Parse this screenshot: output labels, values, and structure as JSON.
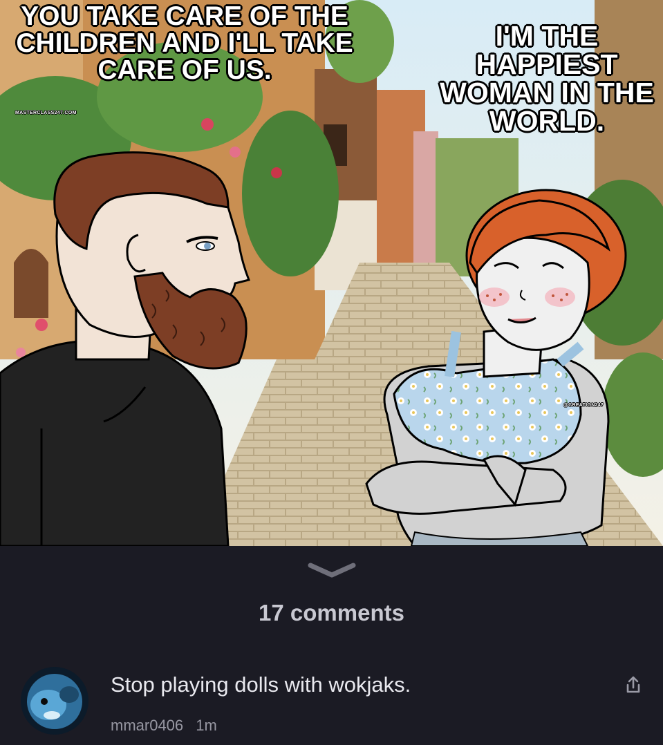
{
  "meme": {
    "caption_left": "YOU TAKE CARE OF THE CHILDREN AND I'LL TAKE CARE OF US.",
    "caption_right": "I'M THE HAPPIEST WOMAN IN THE WORLD.",
    "watermark_left": "MASTERCLASS247.COM",
    "watermark_right": "@CREATION247"
  },
  "comments": {
    "count_label": "17 comments",
    "expand_icon": "chevron-down-icon",
    "items": [
      {
        "text": "Stop playing dolls with wokjaks.",
        "username": "mmar0406",
        "time": "1m",
        "share_icon": "share-icon"
      }
    ]
  },
  "colors": {
    "background": "#1b1b24",
    "count_text": "#c9c9d2",
    "comment_text": "#e9e9ef",
    "meta_text": "#9797a2"
  }
}
